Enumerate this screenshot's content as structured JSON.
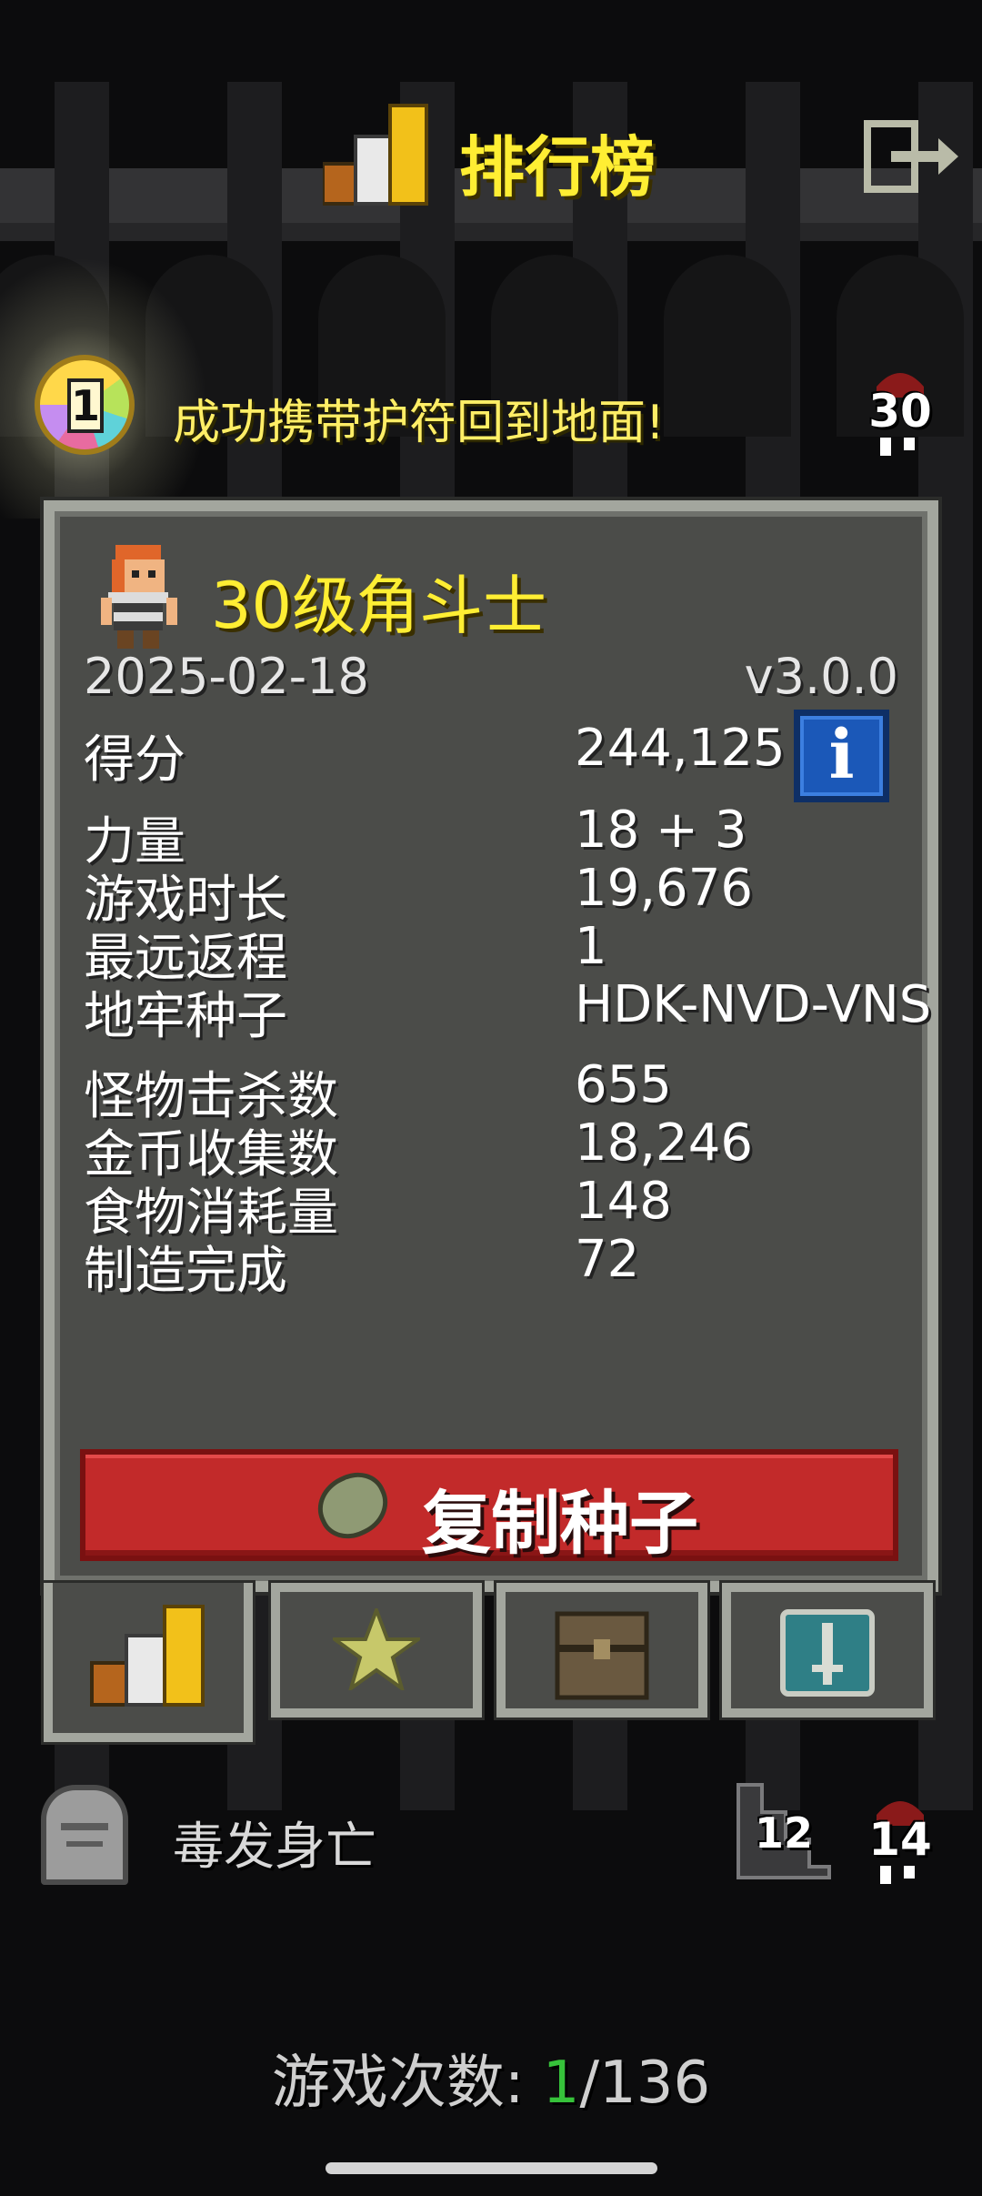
{
  "header": {
    "title": "排行榜",
    "exit_icon": "exit-door-icon"
  },
  "badge": {
    "medal_number": "1",
    "text": "成功携带护符回到地面!",
    "depth": "30"
  },
  "record": {
    "hero_title": "30级角斗士",
    "date": "2025-02-18",
    "version": "v3.0.0",
    "stats": [
      {
        "label": "得分",
        "value": "244,125"
      },
      {
        "label": "力量",
        "value": "18 + 3"
      },
      {
        "label": "游戏时长",
        "value": "19,676"
      },
      {
        "label": "最远返程",
        "value": "1"
      },
      {
        "label": "地牢种子",
        "value": "HDK-NVD-VNS"
      },
      {
        "label": "怪物击杀数",
        "value": "655"
      },
      {
        "label": "金币收集数",
        "value": "18,246"
      },
      {
        "label": "食物消耗量",
        "value": "148"
      },
      {
        "label": "制造完成",
        "value": "72"
      }
    ],
    "info_label": "i",
    "copy_seed_label": "复制种子"
  },
  "tabs": [
    {
      "name": "rankings",
      "icon": "podium-icon"
    },
    {
      "name": "badges",
      "icon": "star-icon"
    },
    {
      "name": "items",
      "icon": "chest-icon"
    },
    {
      "name": "challenges",
      "icon": "sword-icon"
    }
  ],
  "footer": {
    "death_cause": "毒发身亡",
    "floor": "12",
    "depth": "14",
    "games_label": "游戏次数: ",
    "games_current": "1",
    "games_total": "/136"
  },
  "colors": {
    "accent_yellow": "#ffee33",
    "button_red": "#c22a2a",
    "info_blue": "#1b58b8",
    "games_current_green": "#36c23a"
  }
}
